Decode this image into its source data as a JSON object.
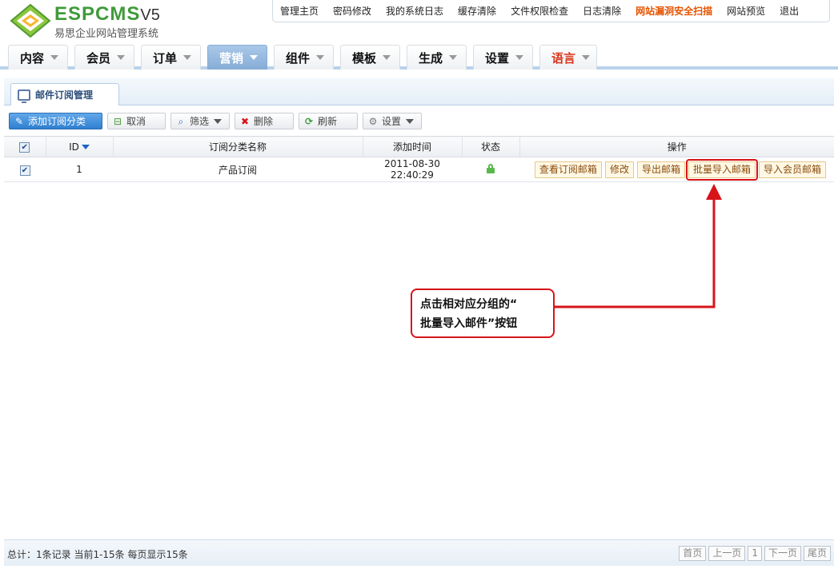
{
  "brand": {
    "name_espcms": "ESPCMS",
    "version": "V5",
    "subtitle": "易思企业网站管理系统"
  },
  "topnav": {
    "items": [
      "管理主页",
      "密码修改",
      "我的系统日志",
      "缓存清除",
      "文件权限检查",
      "日志清除",
      "网站漏洞安全扫描",
      "网站预览",
      "退出"
    ],
    "highlight_index": 6
  },
  "mainnav": {
    "items": [
      "内容",
      "会员",
      "订单",
      "营销",
      "组件",
      "模板",
      "生成",
      "设置",
      "语言"
    ],
    "active_index": 3,
    "red_index": 8
  },
  "panel": {
    "tab_label": "邮件订阅管理"
  },
  "toolbar": {
    "add_label": "添加订阅分类",
    "cancel_label": "取消",
    "filter_label": "筛选",
    "delete_label": "删除",
    "refresh_label": "刷新",
    "settings_label": "设置"
  },
  "table": {
    "headers": {
      "id": "ID",
      "name": "订阅分类名称",
      "time": "添加时间",
      "status": "状态",
      "ops": "操作"
    },
    "rows": [
      {
        "checked": true,
        "id": "1",
        "name": "产品订阅",
        "time": "2011-08-30 22:40:29",
        "status_icon": "unlock-icon",
        "ops": [
          "查看订阅邮箱",
          "修改",
          "导出邮箱",
          "批量导入邮箱",
          "导入会员邮箱"
        ],
        "highlight_op_index": 3
      }
    ]
  },
  "callout": {
    "line1": "点击相对应分组的“",
    "line2": "批量导入邮件”按钮"
  },
  "footer": {
    "stats": "总计：1条记录 当前1-15条 每页显示15条",
    "pager": {
      "first": "首页",
      "prev": "上一页",
      "page": "1",
      "next": "下一页",
      "last": "尾页"
    }
  },
  "colors": {
    "brand_green": "#3f9a3a",
    "accent_blue": "#2f7fd0",
    "alert_red": "#d7141a",
    "hot_orange": "#e65400"
  }
}
